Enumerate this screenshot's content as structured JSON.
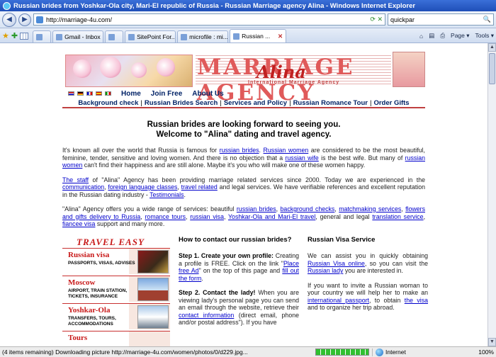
{
  "window": {
    "title": "Russian brides from Yoshkar-Ola city, Mari-El republic of Russia - Russian Marriage agency Alina - Windows Internet Explorer"
  },
  "address": {
    "url": "http://marriage-4u.com/",
    "search_value": "quickpar"
  },
  "tabs": [
    {
      "label": ""
    },
    {
      "label": "Gmail - Inbox"
    },
    {
      "label": ""
    },
    {
      "label": "SitePoint For..."
    },
    {
      "label": "microfile : mi..."
    },
    {
      "label": "Russian ..."
    }
  ],
  "commands": {
    "page": "Page ▾",
    "tools": "Tools ▾"
  },
  "site": {
    "brand": "MARRIAGE AGENCY",
    "brand_script": "Alina",
    "tagline": "International Marriage Agency",
    "topnav": [
      "Home",
      "Join Free",
      "About Us"
    ],
    "catnav": [
      "Background check",
      "Russian Brides Search",
      "Services and Policy",
      "Russian Romance Tour",
      "Order Gifts"
    ],
    "welcome_line1": "Russian brides are looking forward to seeing you.",
    "welcome_line2": "Welcome to \"Alina\" dating and travel agency.",
    "para1": {
      "t1": "It's known all over the world that Russia is famous for ",
      "l1": "russian brides",
      "t2": ". ",
      "l2": "Russian women",
      "t3": " are considered to be the most beautiful, feminine, tender, sensitive and loving women. And there is no objection that a ",
      "l3": "russian wife",
      "t4": " is the best wife. But many of ",
      "l4": "russian women",
      "t5": " can't find their happiness and are still alone. Maybe it's you who will make one of these women happy."
    },
    "para2": {
      "l1": "The staff",
      "t1": " of \"Alina\" Agency has been providing marriage related services since 2000. Today we are experienced in the ",
      "l2": "communication",
      "t2": ", ",
      "l3": "foreign language classes",
      "t3": ", ",
      "l4": "travel related",
      "t4": " and legal services. We have verifiable references and excellent reputation in the Russian dating industry - ",
      "l5": "Testimonials",
      "t5": "."
    },
    "para3": {
      "t1": "\"Alina\" Agency offers you a wide range of services: beautiful ",
      "l1": "russian brides",
      "t2": ", ",
      "l2": "background checks",
      "t3": ", ",
      "l3": "matchmaking services",
      "t4": ", ",
      "l4": "flowers and gifts delivery to Russia",
      "t5": ", ",
      "l5": "romance tours",
      "t6": ", ",
      "l6": "russian visa",
      "t7": ", ",
      "l7": "Yoshkar-Ola and Mari-El travel",
      "t8": ", general and legal ",
      "l8": "translation service",
      "t9": ", ",
      "l9": "fiancee visa",
      "t10": " support and many more."
    },
    "travel": {
      "title": "TRAVEL EASY",
      "cards": [
        {
          "name": "Russian visa",
          "desc": "Passports, visas, advises"
        },
        {
          "name": "Moscow",
          "desc": "Airport, train station, tickets, insurance"
        },
        {
          "name": "Yoshkar-Ola",
          "desc": "Transfers, tours, accommodations"
        },
        {
          "name": "Tours",
          "desc": ""
        }
      ]
    },
    "contact": {
      "heading": "How to contact our russian brides?",
      "step1_title": "Step 1. Create your own profile:",
      "step1_t1": " Creating a profile is FREE. Click on the link \"",
      "step1_l1": "Place free Ad",
      "step1_t2": "\" on the top of this page and ",
      "step1_l2": "fill out the form",
      "step1_t3": ".",
      "step2_title": "Step 2. Contact the lady!",
      "step2_t1": " When you are viewing lady's personal page you can send an email through the website, retrieve their ",
      "step2_l1": "contact information",
      "step2_t2": " (direct email, phone and/or postal address\"). If you have"
    },
    "visa": {
      "heading": "Russian Visa Service",
      "p1_t1": "We can assist you in quickly obtaining ",
      "p1_l1": "Russian Visa online",
      "p1_t2": ", so you can visit the ",
      "p1_l2": "Russian lady",
      "p1_t3": " you are interested in.",
      "p2_t1": "If you want to invite a Russian woman to your country we will help her to make an ",
      "p2_l1": "international passport",
      "p2_t2": ", to obtain ",
      "p2_l2": "the visa",
      "p2_t3": " and to organize her trip abroad."
    }
  },
  "status": {
    "text": "(4 items remaining) Downloading picture http://marriage-4u.com/women/photos/0/d229.jpg...",
    "zone": "Internet",
    "zoom": "100%"
  },
  "colors": {
    "brand_red": "#c81a1a",
    "link_blue": "#0000cc",
    "nav_blue": "#002266"
  }
}
